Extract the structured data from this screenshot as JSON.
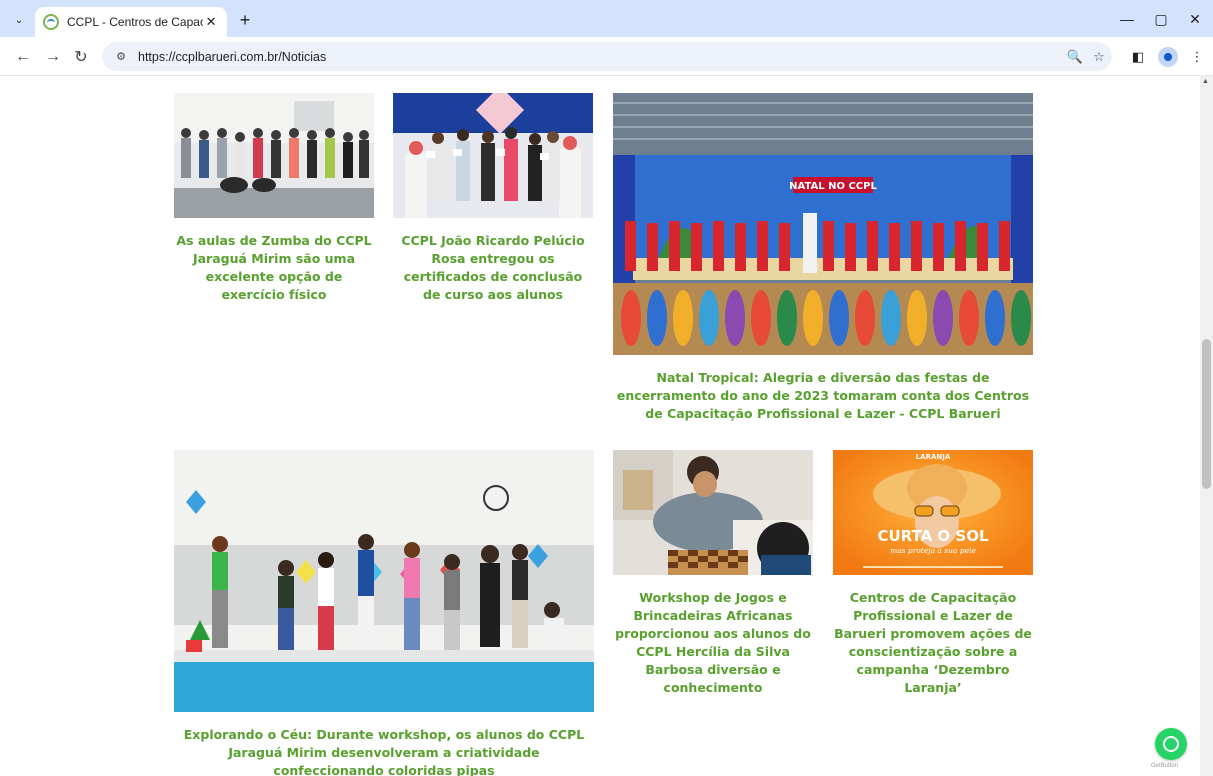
{
  "browser": {
    "tab_title": "CCPL - Centros de Capacitação",
    "tab_close": "✕",
    "new_tab": "+",
    "url": "https://ccplbarueri.com.br/Noticias",
    "minimize": "—",
    "maximize": "▢",
    "close": "✕"
  },
  "news": [
    {
      "caption": "As aulas de Zumba do CCPL Jaraguá Mirim são uma excelente opção de exercício físico"
    },
    {
      "caption": "CCPL João Ricardo Pelúcio Rosa entregou os certificados de conclusão de curso aos alunos"
    },
    {
      "caption": "Natal Tropical: Alegria e diversão das festas de encerramento do ano de 2023 tomaram conta dos Centros de Capacitação Profissional e Lazer - CCPL Barueri"
    },
    {
      "caption": "Explorando o Céu: Durante workshop, os alunos do CCPL Jaraguá Mirim desenvolveram a criatividade confeccionando coloridas pipas"
    },
    {
      "caption": "Workshop de Jogos e Brincadeiras Africanas proporcionou aos alunos do CCPL Hercília da Silva Barbosa diversão e conhecimento"
    },
    {
      "caption": "Centros de Capacitação Profissional e Lazer de Barueri promovem ações de conscientização sobre a campanha ‘Dezembro Laranja’"
    }
  ],
  "images": {
    "natal_banner": "NATAL NO CCPL",
    "laranja_top": "LARANJA",
    "curta_title": "CURTA O SOL",
    "curta_sub": "mas proteja a sua pele"
  },
  "widget": {
    "getbutton": "GetButton"
  },
  "colors": {
    "caption": "#58a12f",
    "tabstrip": "#d3e3fd",
    "whatsapp": "#25d366"
  }
}
